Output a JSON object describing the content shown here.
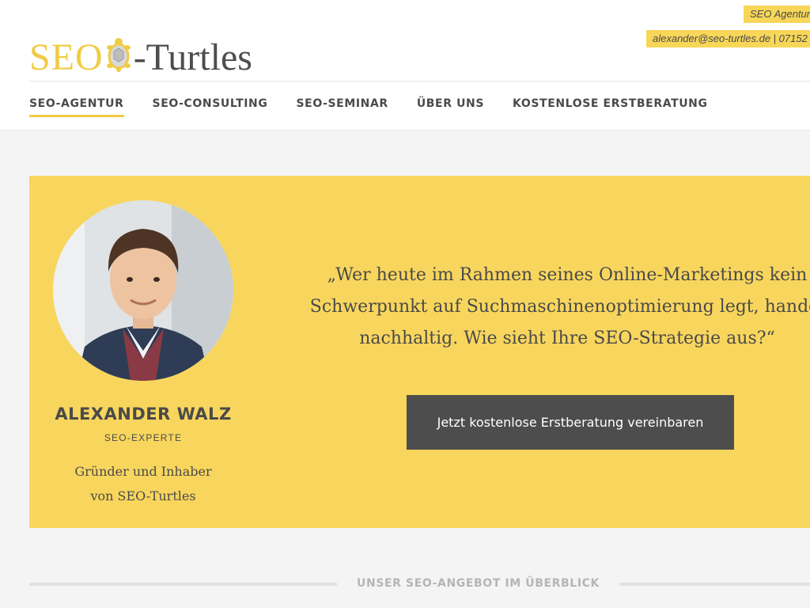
{
  "header": {
    "tag_top": "SEO Agentur",
    "contact": "alexander@seo-turtles.de | 07152",
    "logo": {
      "part1": "SEO",
      "part2": "-Turtles",
      "icon": "turtle-logo-icon"
    }
  },
  "nav": {
    "items": [
      {
        "label": "SEO-AGENTUR",
        "active": true
      },
      {
        "label": "SEO-CONSULTING",
        "active": false
      },
      {
        "label": "SEO-SEMINAR",
        "active": false
      },
      {
        "label": "ÜBER UNS",
        "active": false
      },
      {
        "label": "KOSTENLOSE ERSTBERATUNG",
        "active": false
      }
    ]
  },
  "hero": {
    "person": {
      "name": "ALEXANDER WALZ",
      "role": "SEO-EXPERTE",
      "desc_line1": "Gründer und Inhaber",
      "desc_line2": "von SEO-Turtles"
    },
    "quote": {
      "line1": "„Wer heute im Rahmen seines Online-Marketings kein",
      "line2": "Schwerpunkt auf Suchmaschinenoptimierung legt, handel",
      "line3": "nachhaltig. Wie sieht Ihre SEO-Strategie aus?“"
    },
    "cta_label": "Jetzt kostenlose Erstberatung vereinbaren"
  },
  "section": {
    "title": "UNSER SEO-ANGEBOT IM ÜBERBLICK"
  },
  "colors": {
    "accent": "#f8d65d",
    "logo_yellow": "#f0cb45",
    "dark": "#4d4d4d",
    "background": "#f4f4f4"
  }
}
